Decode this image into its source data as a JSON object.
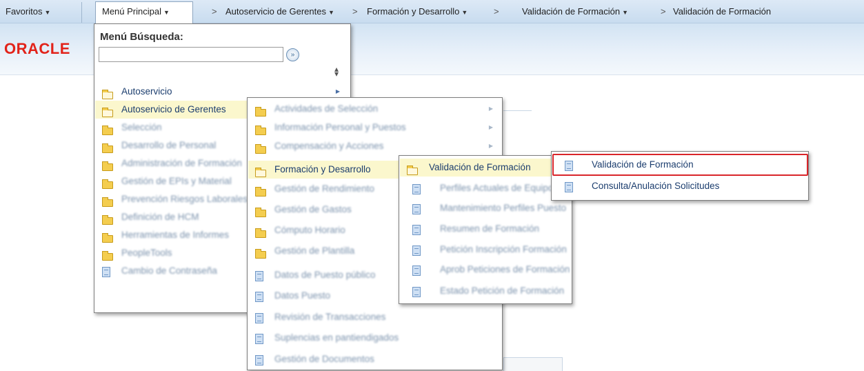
{
  "nav": {
    "favorites": "Favoritos",
    "main_menu": "Menú Principal",
    "sep": ">",
    "crumb1": "Autoservicio de Gerentes",
    "crumb2": "Formación y Desarrollo",
    "crumb3": "Validación de Formación",
    "crumb4": "Validación de Formación"
  },
  "logo": "ORACLE",
  "search": {
    "title": "Menú Búsqueda:",
    "value": "",
    "go_icon": "arrow-go-icon",
    "sort_icon": "sort-icon"
  },
  "main_menu": {
    "items": [
      {
        "label": "Autoservicio",
        "icon": "folder-icon",
        "state": "normal"
      },
      {
        "label": "Autoservicio de Gerentes",
        "icon": "folder-icon",
        "state": "selected"
      },
      {
        "label": "Selección",
        "icon": "folder-icon",
        "state": "blurred"
      },
      {
        "label": "Desarrollo de Personal",
        "icon": "folder-icon",
        "state": "blurred"
      },
      {
        "label": "Administración de Formación",
        "icon": "folder-icon",
        "state": "blurred"
      },
      {
        "label": "Gestión de EPIs y Material",
        "icon": "folder-icon",
        "state": "blurred"
      },
      {
        "label": "Prevención Riesgos Laborales",
        "icon": "folder-icon",
        "state": "blurred"
      },
      {
        "label": "Definición de HCM",
        "icon": "folder-icon",
        "state": "blurred"
      },
      {
        "label": "Herramientas de Informes",
        "icon": "folder-icon",
        "state": "blurred"
      },
      {
        "label": "PeopleTools",
        "icon": "folder-icon",
        "state": "blurred"
      },
      {
        "label": "Cambio de Contraseña",
        "icon": "document-icon",
        "state": "blurred"
      }
    ]
  },
  "submenu_gerentes": {
    "items": [
      {
        "label": "Actividades de Selección",
        "icon": "folder-icon",
        "state": "blurred"
      },
      {
        "label": "Información Personal y Puestos",
        "icon": "folder-icon",
        "state": "blurred"
      },
      {
        "label": "Compensación y Acciones",
        "icon": "folder-icon",
        "state": "blurred"
      },
      {
        "label": "Formación y Desarrollo",
        "icon": "folder-icon",
        "state": "selected"
      },
      {
        "label": "Gestión de Rendimiento",
        "icon": "folder-icon",
        "state": "blurred"
      },
      {
        "label": "Gestión de Gastos",
        "icon": "folder-icon",
        "state": "blurred"
      },
      {
        "label": "Cómputo Horario",
        "icon": "folder-icon",
        "state": "blurred"
      },
      {
        "label": "Gestión de Plantilla",
        "icon": "folder-icon",
        "state": "blurred"
      },
      {
        "label": "Datos de Puesto público",
        "icon": "document-icon",
        "state": "blurred"
      },
      {
        "label": "Datos Puesto",
        "icon": "document-icon",
        "state": "blurred"
      },
      {
        "label": "Revisión de Transacciones",
        "icon": "document-icon",
        "state": "blurred"
      },
      {
        "label": "Suplencias en pantiendigados",
        "icon": "document-icon",
        "state": "blurred"
      },
      {
        "label": "Gestión de Documentos",
        "icon": "document-icon",
        "state": "blurred"
      }
    ]
  },
  "submenu_formacion": {
    "items": [
      {
        "label": "Validación de Formación",
        "icon": "folder-icon",
        "state": "selected"
      },
      {
        "label": "Perfiles Actuales de Equipo",
        "icon": "document-icon",
        "state": "blurred"
      },
      {
        "label": "Mantenimiento Perfiles Puesto",
        "icon": "document-icon",
        "state": "blurred"
      },
      {
        "label": "Resumen de Formación",
        "icon": "document-icon",
        "state": "blurred"
      },
      {
        "label": "Petición Inscripción Formación",
        "icon": "document-icon",
        "state": "blurred"
      },
      {
        "label": "Aprob Peticiones de Formación",
        "icon": "document-icon",
        "state": "blurred"
      },
      {
        "label": "Estado Petición de Formación",
        "icon": "document-icon",
        "state": "blurred"
      }
    ]
  },
  "submenu_validacion": {
    "items": [
      {
        "label": "Validación de Formación",
        "icon": "document-icon",
        "state": "highlighted"
      },
      {
        "label": "Consulta/Anulación Solicitudes",
        "icon": "document-icon",
        "state": "normal"
      }
    ]
  },
  "colors": {
    "highlight_border": "#d9252a",
    "selected_row": "#fbf7cd",
    "logo": "#e2231a"
  }
}
